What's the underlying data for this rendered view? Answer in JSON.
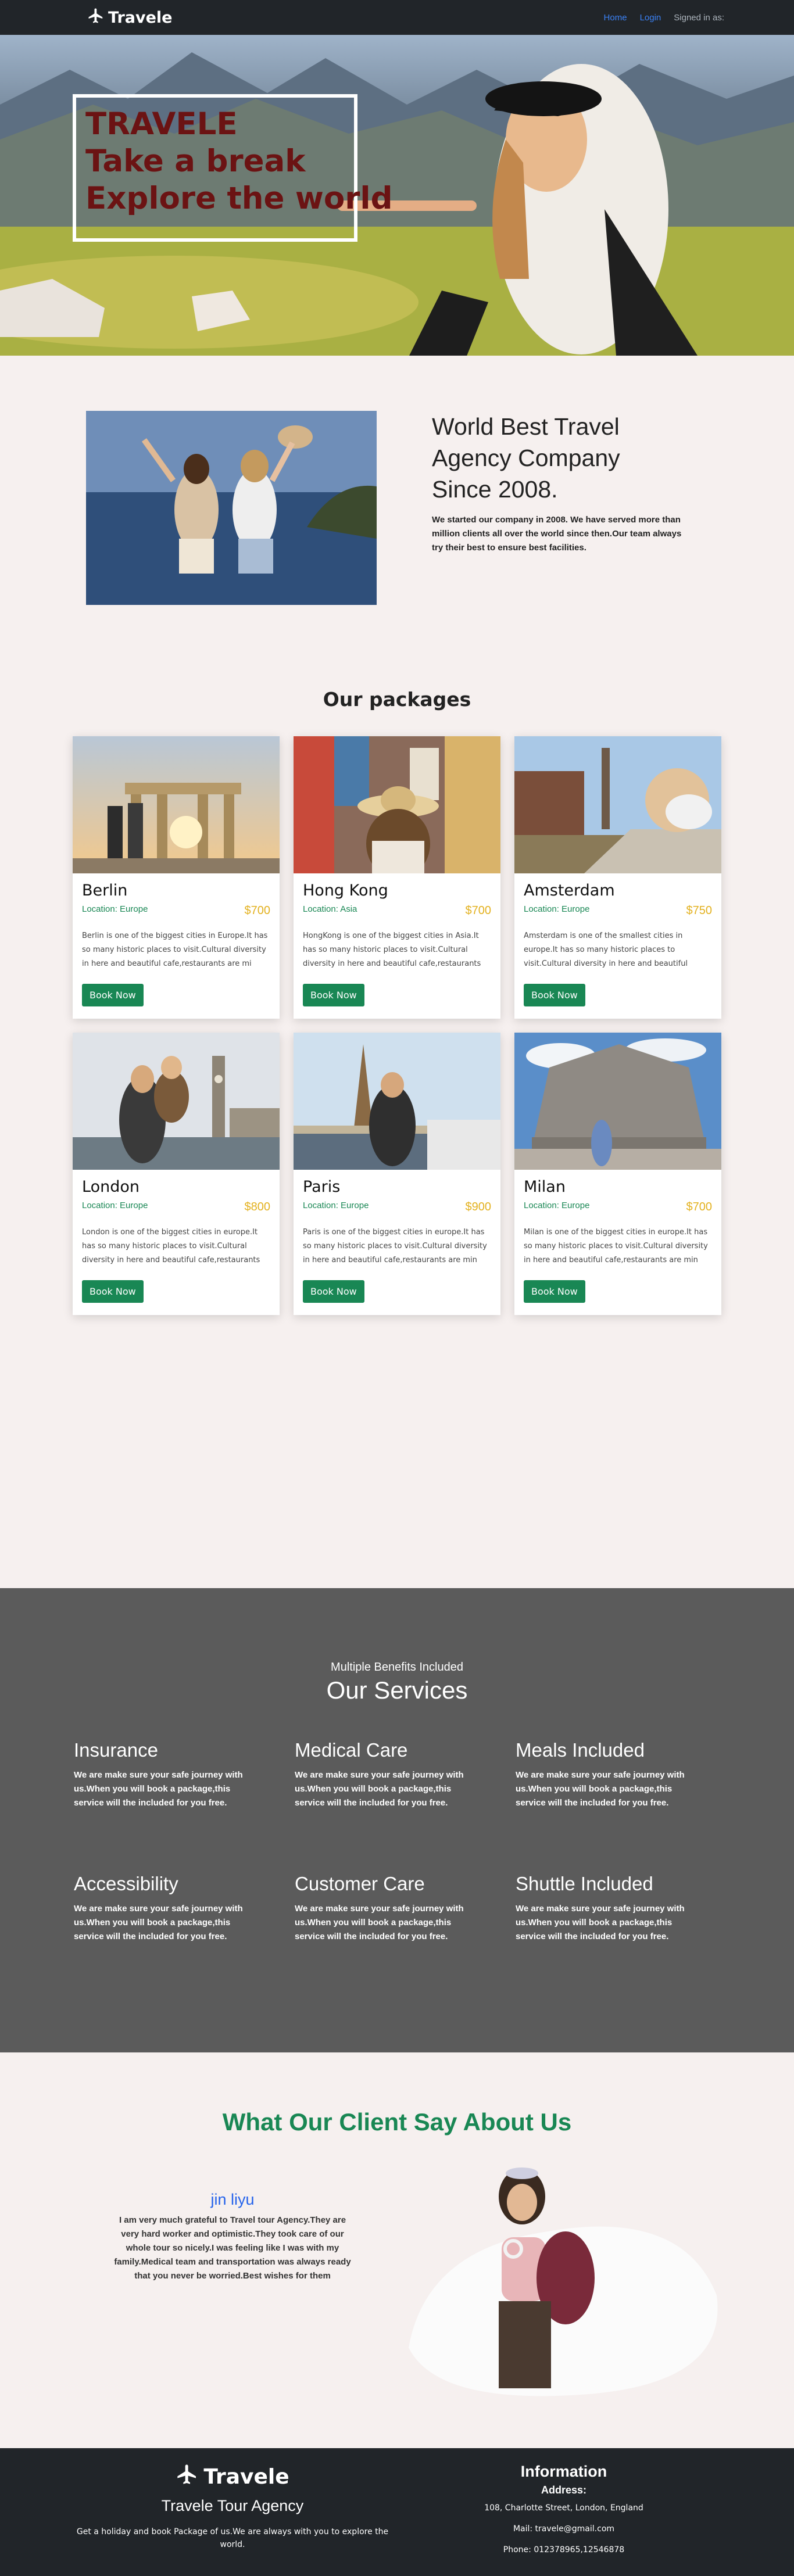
{
  "navbar": {
    "brand": "Travele",
    "links": {
      "home": "Home",
      "login": "Login",
      "signed": "Signed in as:"
    }
  },
  "hero": {
    "lines": [
      "TRAVELE",
      "Take a break",
      "Explore the world"
    ]
  },
  "about": {
    "title_lines": [
      "World Best Travel",
      "Agency Company",
      "Since 2008."
    ],
    "description": "We started our company in 2008. We have served more than million clients all over the world since then.Our team always try their best to ensure best facilities."
  },
  "packages": {
    "title": "Our packages",
    "button_label": "Book Now",
    "items": [
      {
        "city": "Berlin",
        "location": "Location: Europe",
        "price": "$700",
        "description": "Berlin is one of the biggest cities in Europe.It has so many historic places to visit.Cultural diversity in here and beautiful cafe,restaurants are mi"
      },
      {
        "city": "Hong Kong",
        "location": "Location: Asia",
        "price": "$700",
        "description": "HongKong is one of the biggest cities in Asia.It has so many historic places to visit.Cultural diversity in here and beautiful cafe,restaurants are mi"
      },
      {
        "city": "Amsterdam",
        "location": "Location: Europe",
        "price": "$750",
        "description": "Amsterdam is one of the smallest cities in europe.It has so many historic places to visit.Cultural diversity in here and beautiful cafe,restaurants ar"
      },
      {
        "city": "London",
        "location": "Location: Europe",
        "price": "$800",
        "description": "London is one of the biggest cities in europe.It has so many historic places to visit.Cultural diversity in here and beautiful cafe,restaurants are mi"
      },
      {
        "city": "Paris",
        "location": "Location: Europe",
        "price": "$900",
        "description": "Paris is one of the biggest cities in europe.It has so many historic places to visit.Cultural diversity in here and beautiful cafe,restaurants are min"
      },
      {
        "city": "Milan",
        "location": "Location: Europe",
        "price": "$700",
        "description": "Milan is one of the biggest cities in europe.It has so many historic places to visit.Cultural diversity in here and beautiful cafe,restaurants are min"
      }
    ]
  },
  "services": {
    "subtitle": "Multiple Benefits Included",
    "title": "Our Services",
    "items": [
      {
        "name": "Insurance",
        "description": "We are make sure your safe journey with us.When you will book a package,this service will the included for you free."
      },
      {
        "name": "Medical Care",
        "description": "We are make sure your safe journey with us.When you will book a package,this service will the included for you free."
      },
      {
        "name": "Meals Included",
        "description": "We are make sure your safe journey with us.When you will book a package,this service will the included for you free."
      },
      {
        "name": "Accessibility",
        "description": "We are make sure your safe journey with us.When you will book a package,this service will the included for you free."
      },
      {
        "name": "Customer Care",
        "description": "We are make sure your safe journey with us.When you will book a package,this service will the included for you free."
      },
      {
        "name": "Shuttle Included",
        "description": "We are make sure your safe journey with us.When you will book a package,this service will the included for you free."
      }
    ]
  },
  "testimonial": {
    "title": "What Our Client Say About Us",
    "name": "jin liyu",
    "text": "I am very much grateful to Travel tour Agency.They are very hard worker and optimistic.They took care of our whole tour so nicely.I was feeling like I was with my family.Medical team and transportation was always ready that you never be worried.Best wishes for them"
  },
  "footer": {
    "brand": "Travele",
    "agency": "Travele Tour Agency",
    "description": "Get a holiday and book Package of us.We are always with you to explore the world.",
    "info_title": "Information",
    "address_label": "Address:",
    "address": "108, Charlotte Street, London, England",
    "mail": "Mail: travele@gmail.com",
    "phone": "Phone: 012378965,12546878"
  },
  "colors": {
    "nav_bg": "#212529",
    "accent_green": "#198754",
    "price_gold": "#e3b11f",
    "hero_text": "#6b1313",
    "services_bg": "#5b5b5b",
    "link_blue": "#3b82f6"
  },
  "icons": {
    "brand": "plane-icon"
  }
}
